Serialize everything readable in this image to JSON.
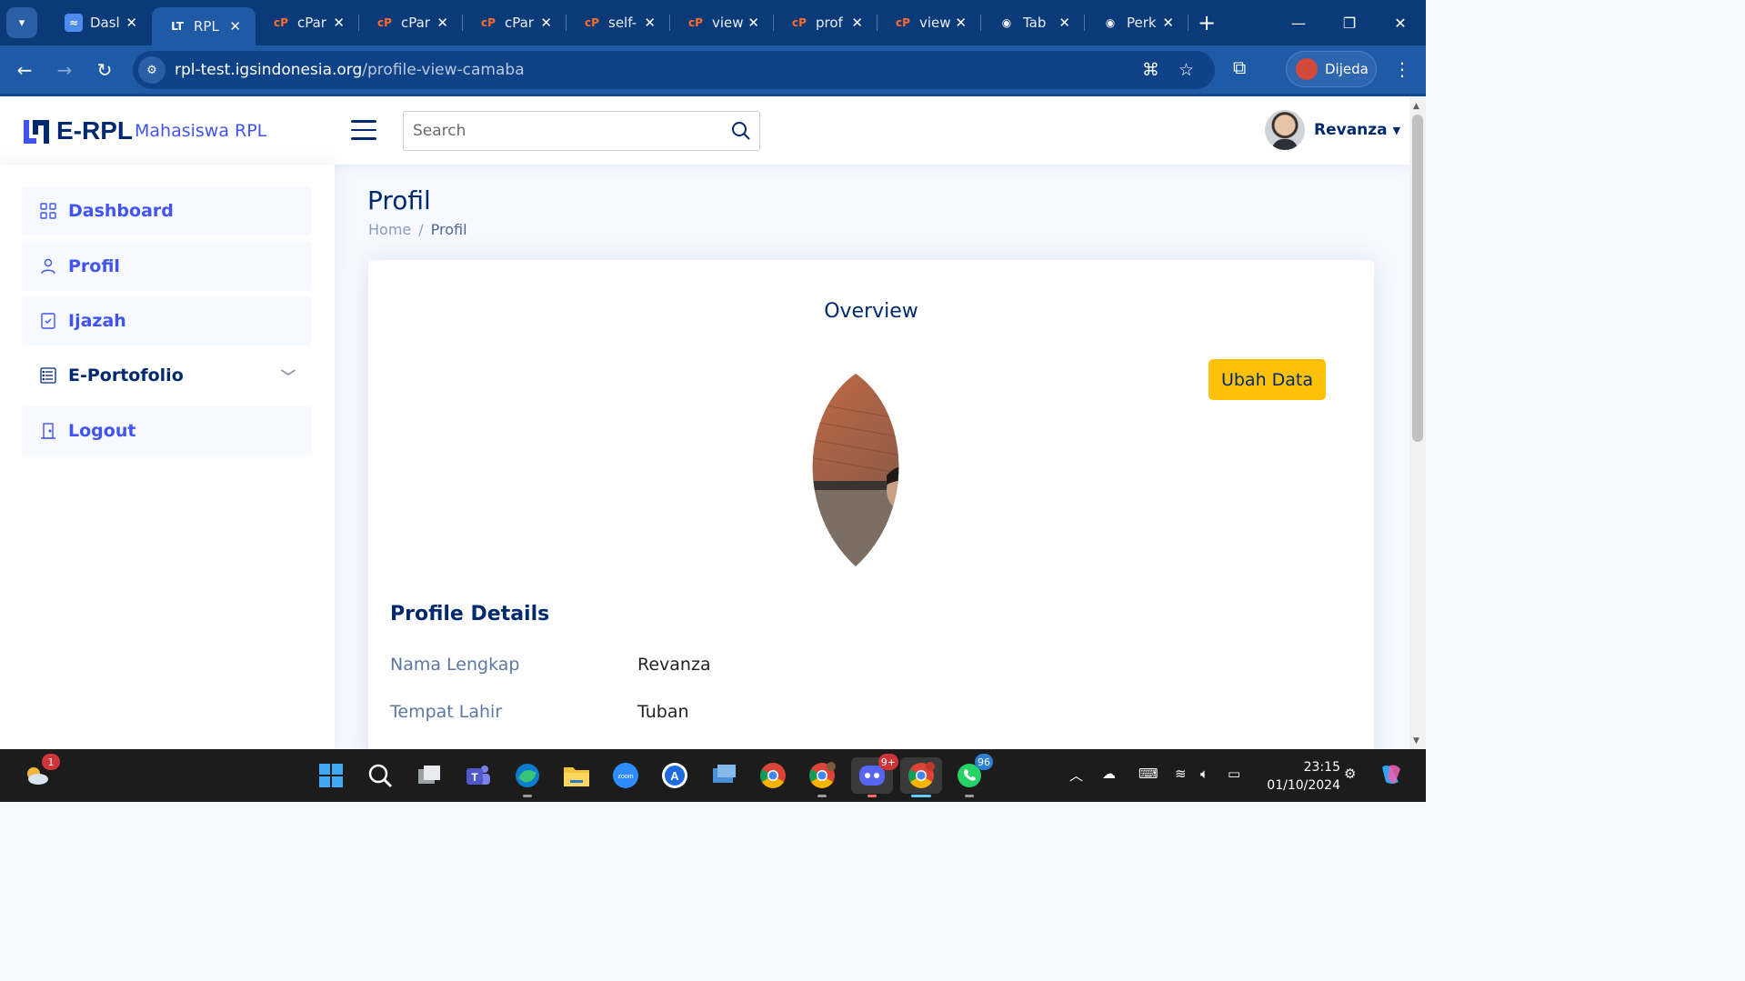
{
  "browser": {
    "tabs": [
      {
        "title": "Dasl",
        "icon": "wave-icon",
        "color": "#4e8cf0"
      },
      {
        "title": "RPL",
        "icon": "erpl-icon",
        "color": "#ffffff",
        "active": true
      },
      {
        "title": "cPar",
        "icon": "cpanel-icon",
        "color": "#ff6c2c"
      },
      {
        "title": "cPar",
        "icon": "cpanel-icon",
        "color": "#ff6c2c"
      },
      {
        "title": "cPar",
        "icon": "cpanel-icon",
        "color": "#ff6c2c"
      },
      {
        "title": "self-",
        "icon": "cpanel-icon",
        "color": "#ff6c2c"
      },
      {
        "title": "view",
        "icon": "cpanel-icon",
        "color": "#ff6c2c"
      },
      {
        "title": "prof",
        "icon": "cpanel-icon",
        "color": "#ff6c2c"
      },
      {
        "title": "view",
        "icon": "cpanel-icon",
        "color": "#ff6c2c"
      },
      {
        "title": "Tab",
        "icon": "chrome-icon",
        "color": "#ffffff"
      },
      {
        "title": "Perk",
        "icon": "openai-icon",
        "color": "#ffffff"
      }
    ],
    "url_host": "rpl-test.igsindonesia.org",
    "url_path": "/profile-view-camaba",
    "profile_name": "Dijeda"
  },
  "header": {
    "logo_text": "E-RPL",
    "logo_sub": "Mahasiswa RPL",
    "search_placeholder": "Search",
    "user_name": "Revanza"
  },
  "sidebar": {
    "items": [
      {
        "label": "Dashboard",
        "icon": "grid-icon"
      },
      {
        "label": "Profil",
        "icon": "person-icon"
      },
      {
        "label": "Ijazah",
        "icon": "journal-check-icon"
      },
      {
        "label": "E-Portofolio",
        "icon": "list-icon"
      },
      {
        "label": "Logout",
        "icon": "door-icon"
      }
    ]
  },
  "main": {
    "title": "Profil",
    "breadcrumb": [
      "Home",
      "Profil"
    ],
    "overview_title": "Overview",
    "edit_button": "Ubah Data",
    "details_title": "Profile Details",
    "details": [
      {
        "label": "Nama Lengkap",
        "value": "Revanza"
      },
      {
        "label": "Tempat Lahir",
        "value": "Tuban"
      }
    ]
  },
  "taskbar": {
    "weather_badge": "1",
    "discord_badge": "9+",
    "whatsapp_badge": "96",
    "time": "23:15",
    "date": "01/10/2024"
  },
  "colors": {
    "brand": "#012970",
    "accent": "#4154f1",
    "button": "#ffc107"
  }
}
